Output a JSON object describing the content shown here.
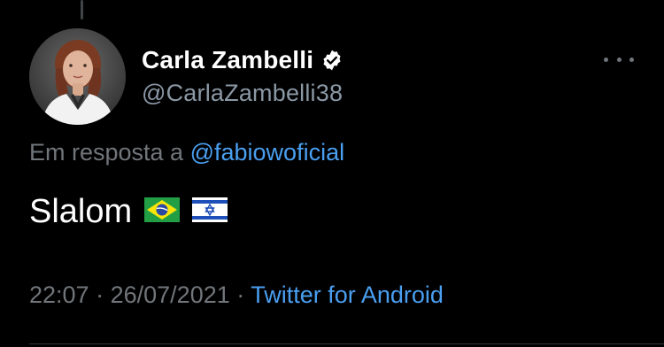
{
  "author": {
    "display_name": "Carla Zambelli",
    "handle": "@CarlaZambelli38",
    "verified": true,
    "avatar_icon": "profile-photo"
  },
  "reply": {
    "prefix": "Em resposta a",
    "mention": "@fabiowoficial"
  },
  "tweet": {
    "text": "Slalom",
    "emoji": [
      "brazil-flag-icon",
      "israel-flag-icon"
    ]
  },
  "meta": {
    "time": "22:07",
    "separator1": "·",
    "date": "26/07/2021",
    "separator2": "·",
    "source": "Twitter for Android"
  },
  "colors": {
    "background": "#000000",
    "link": "#4a9ff0",
    "secondary_text": "#71767b",
    "verified_badge": "#ffffff"
  }
}
